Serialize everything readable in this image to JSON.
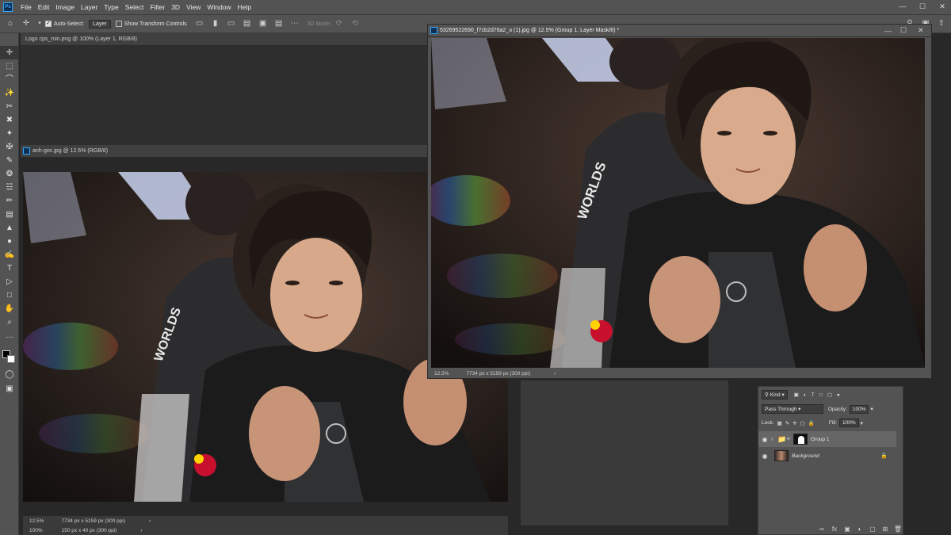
{
  "menubar": {
    "app_icon": "Ps",
    "items": [
      "File",
      "Edit",
      "Image",
      "Layer",
      "Type",
      "Select",
      "Filter",
      "3D",
      "View",
      "Window",
      "Help"
    ],
    "controls": [
      "—",
      "☐",
      "✕"
    ]
  },
  "options_bar": {
    "auto_select_label": "Auto-Select:",
    "auto_select_target": "Layer",
    "show_transform_label": "Show Transform Controls",
    "mode_3d_label": "3D Mode:",
    "icons": [
      "home-icon",
      "move-icon",
      "align-icons",
      "3d-icons",
      "search-icon",
      "workspace-icon",
      "share-icon"
    ]
  },
  "toolbar": {
    "tools": [
      "✛",
      "⬚",
      "⌒",
      "✨",
      "✂",
      "✖",
      "✦",
      "✠",
      "✎",
      "❂",
      "☳",
      "✏",
      "▤",
      "▲",
      "●",
      "✍",
      "T",
      "▷",
      "□",
      "✋",
      "⌕",
      "…"
    ]
  },
  "documents": {
    "logo_doc": {
      "title": "Logo cps_min.png @ 100% (Layer 1, RGB/8)",
      "zoom": "100%",
      "size": "150 px x 40 px (300 ppi)"
    },
    "anh_goc": {
      "title": "anh-goc.jpg @ 12.5% (RGB/8)",
      "zoom": "12.5%",
      "size": "7734 px x 5159 px (300 ppi)"
    },
    "main_doc": {
      "title": "53269522690_f7cb2d76a2_o (1).jpg @ 12.5% (Group 1, Layer Mask/8) *",
      "zoom": "12.5%",
      "size": "7734 px x 5159 px (300 ppi)"
    }
  },
  "layers_panel": {
    "filter_kind": "Kind",
    "blend_mode": "Pass Through",
    "opacity_label": "Opacity:",
    "opacity_value": "100%",
    "lock_label": "Lock:",
    "fill_label": "Fill:",
    "fill_value": "100%",
    "layers": [
      {
        "name": "Group 1",
        "type": "group",
        "visible": true,
        "selected": true
      },
      {
        "name": "Background",
        "type": "image",
        "visible": true,
        "locked": true
      }
    ]
  },
  "colors": {
    "ui_dark": "#282828",
    "ui_panel": "#535353",
    "accent_blue": "#31a8ff"
  }
}
